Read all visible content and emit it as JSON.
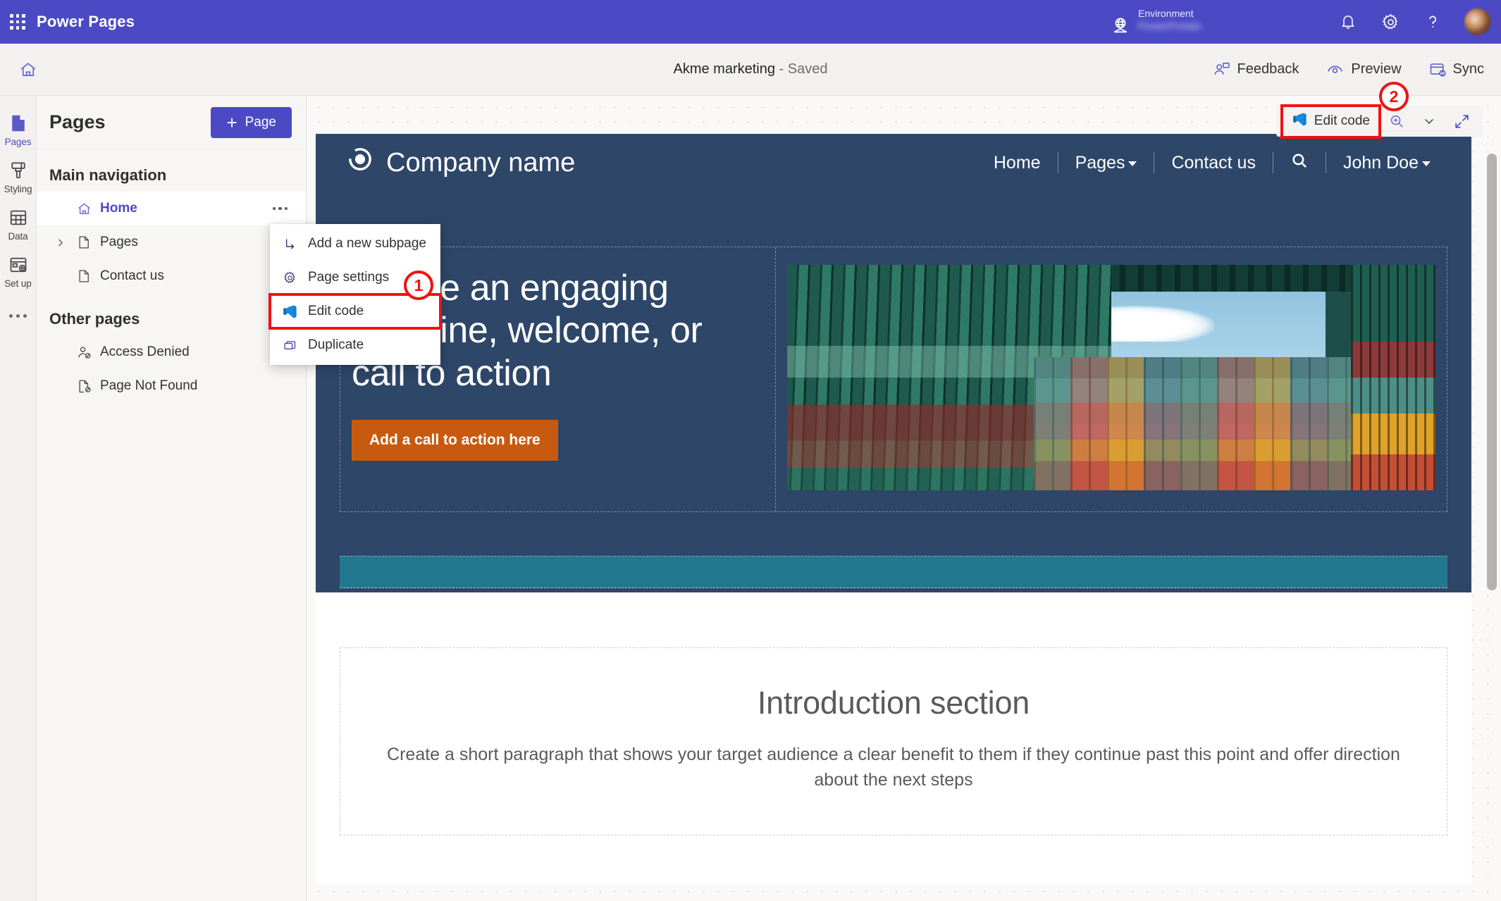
{
  "brand": {
    "waffle_icon": "app-launcher-icon",
    "name": "Power Pages",
    "environment_label": "Environment",
    "environment_value": "PowerPortals",
    "icons": [
      "notifications-bell-icon",
      "settings-gear-icon",
      "help-question-icon",
      "user-avatar"
    ]
  },
  "commandbar": {
    "home_icon": "home-icon",
    "doc_title": "Akme marketing",
    "doc_status": " - Saved",
    "actions": [
      {
        "label": "Feedback",
        "icon": "feedback-icon"
      },
      {
        "label": "Preview",
        "icon": "preview-eye-icon"
      },
      {
        "label": "Sync",
        "icon": "sync-icon"
      }
    ]
  },
  "rail": {
    "items": [
      {
        "label": "Pages",
        "icon": "page-icon",
        "active": true
      },
      {
        "label": "Styling",
        "icon": "paint-brush-icon",
        "active": false
      },
      {
        "label": "Data",
        "icon": "table-grid-icon",
        "active": false
      },
      {
        "label": "Set up",
        "icon": "setup-gear-icon",
        "active": false
      }
    ],
    "overflow": "more-options-icon"
  },
  "panel": {
    "title": "Pages",
    "add_button": {
      "label": "Page",
      "plus": "+"
    },
    "sections": [
      {
        "title": "Main navigation",
        "items": [
          {
            "label": "Home",
            "icon": "home-page-icon",
            "selected": true,
            "has_chevron": false
          },
          {
            "label": "Pages",
            "icon": "file-icon",
            "selected": false,
            "has_chevron": true
          },
          {
            "label": "Contact us",
            "icon": "file-icon",
            "selected": false,
            "has_chevron": false
          }
        ]
      },
      {
        "title": "Other pages",
        "items": [
          {
            "label": "Access Denied",
            "icon": "person-blocked-icon",
            "selected": false,
            "has_chevron": false
          },
          {
            "label": "Page Not Found",
            "icon": "file-blocked-icon",
            "selected": false,
            "has_chevron": false
          }
        ]
      }
    ]
  },
  "context_menu": {
    "items": [
      {
        "label": "Add a new subpage",
        "icon": "subpage-arrow-icon",
        "highlighted": false
      },
      {
        "label": "Page settings",
        "icon": "gear-icon",
        "highlighted": false
      },
      {
        "label": "Edit code",
        "icon": "vscode-icon",
        "highlighted": true
      },
      {
        "label": "Duplicate",
        "icon": "duplicate-icon",
        "highlighted": false
      }
    ]
  },
  "canvas_toolbar": {
    "edit_code_label": "Edit code",
    "edit_code_icon": "vscode-icon",
    "zoom_icon": "zoom-magnifier-icon",
    "zoom_chevron_icon": "chevron-down-icon",
    "fullscreen_icon": "expand-arrows-icon"
  },
  "annotations": {
    "badge_one": "1",
    "badge_two": "2",
    "highlight_color": "#f01212"
  },
  "site_preview": {
    "company_name": "Company name",
    "logo_icon": "circle-logo-icon",
    "nav_links": [
      {
        "label": "Home",
        "has_caret": false
      },
      {
        "label": "Pages",
        "has_caret": true
      },
      {
        "label": "Contact us",
        "has_caret": false
      }
    ],
    "search_icon": "search-icon",
    "user_name": "John Doe",
    "hero": {
      "headline": "Create an engaging headline, welcome, or call to action",
      "cta_label": "Add a call to action here",
      "image_alt": "colorful stacked shipping containers with sky"
    },
    "intro": {
      "title": "Introduction section",
      "body": "Create a short paragraph that shows your target audience a clear benefit to them if they continue past this point and offer direction about the next steps"
    }
  },
  "colors": {
    "brand_purple": "#4b4ac4",
    "site_navy": "#2e4668",
    "teal_band": "#22788f",
    "cta_orange": "#c85a10"
  }
}
